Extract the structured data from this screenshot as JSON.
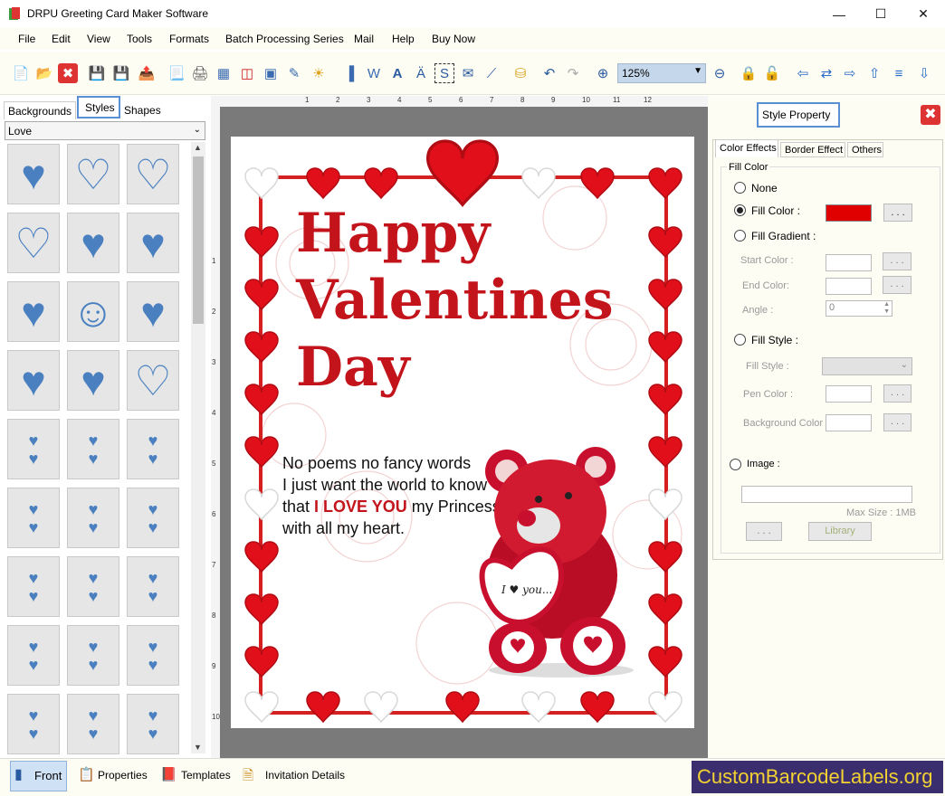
{
  "app": {
    "title": "DRPU Greeting Card Maker Software"
  },
  "menu": [
    "File",
    "Edit",
    "View",
    "Tools",
    "Formats",
    "Batch Processing Series",
    "Mail",
    "Help",
    "Buy Now"
  ],
  "toolbar": {
    "zoom": "125%"
  },
  "left": {
    "tabs": [
      "Backgrounds",
      "Styles",
      "Shapes"
    ],
    "category": "Love"
  },
  "card": {
    "title1": "Happy",
    "title2": "Valentines",
    "title3": "Day",
    "line1": "No poems no fancy words",
    "line2": "I just want the world to know",
    "line3_pre": "that ",
    "line3_em": "I LOVE YOU",
    "line3_post": " my Princess",
    "line4": "with all my heart.",
    "bear_text": "I ♥ you..."
  },
  "props": {
    "title": "Style Property",
    "tabs": [
      "Color Effects",
      "Border Effect",
      "Others"
    ],
    "group": "Fill Color",
    "none": "None",
    "fill_color": "Fill Color :",
    "fill_gradient": "Fill Gradient :",
    "start_color": "Start Color :",
    "end_color": "End Color:",
    "angle": "Angle :",
    "angle_val": "0",
    "fill_style": "Fill Style :",
    "fill_style2": "Fill Style :",
    "pen_color": "Pen Color :",
    "bg_color": "Background Color :",
    "image": "Image :",
    "max_size": "Max Size : 1MB",
    "library": "Library",
    "dots": ". . .",
    "fill_hex": "#e00000"
  },
  "bottom": {
    "front": "Front",
    "properties": "Properties",
    "templates": "Templates",
    "invitation": "Invitation Details"
  },
  "brand": "CustomBarcodeLabels.org"
}
